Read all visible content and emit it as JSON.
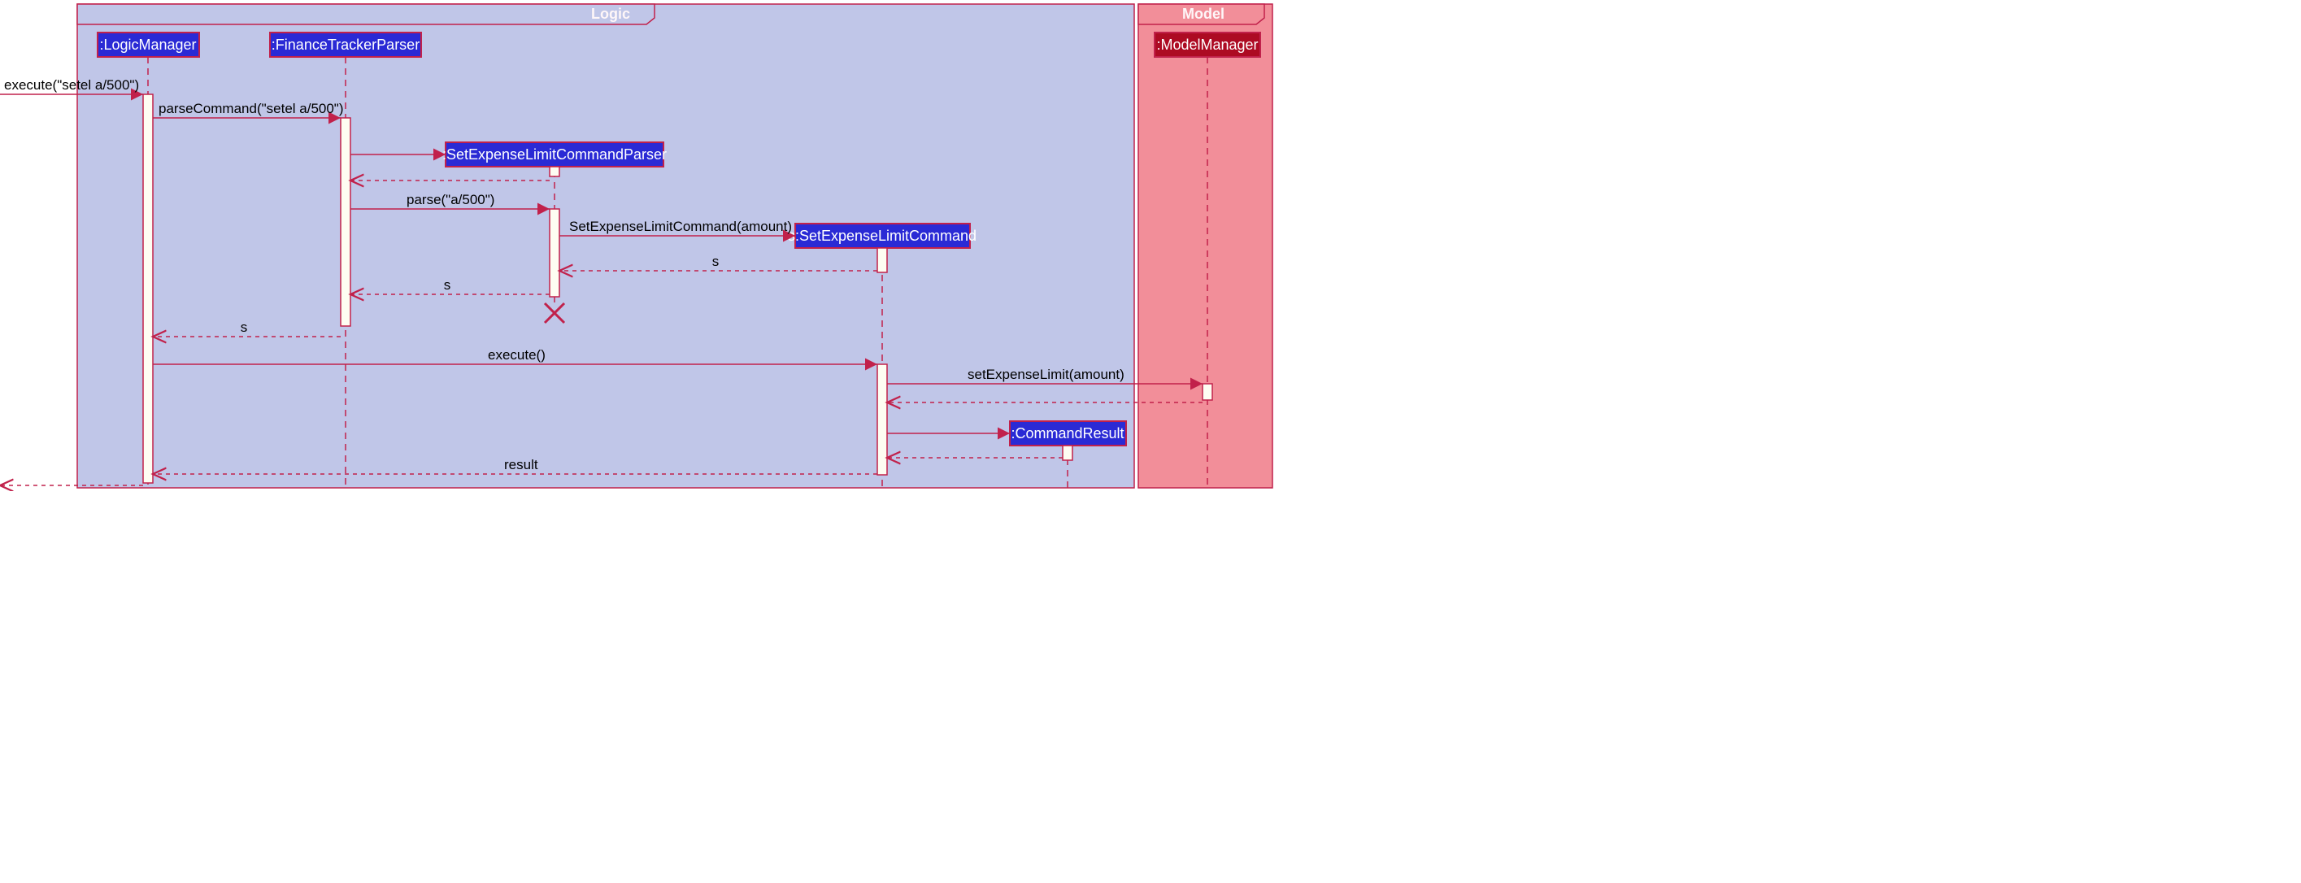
{
  "frames": {
    "logic": {
      "title": "Logic"
    },
    "model": {
      "title": "Model"
    }
  },
  "participants": {
    "logicManager": ":LogicManager",
    "financeTrackerParser": ":FinanceTrackerParser",
    "setExpenseLimitCommandParser": ":SetExpenseLimitCommandParser",
    "setExpenseLimitCommand": "s:SetExpenseLimitCommand",
    "commandResult": ":CommandResult",
    "modelManager": ":ModelManager"
  },
  "messages": {
    "m1": "execute(\"setel a/500\")",
    "m2": "parseCommand(\"setel a/500\")",
    "m3": "parse(\"a/500\")",
    "m4": "SetExpenseLimitCommand(amount)",
    "m5": "s",
    "m6": "s",
    "m7": "s",
    "m8": "execute()",
    "m9": "setExpenseLimit(amount)",
    "m10": "result"
  }
}
